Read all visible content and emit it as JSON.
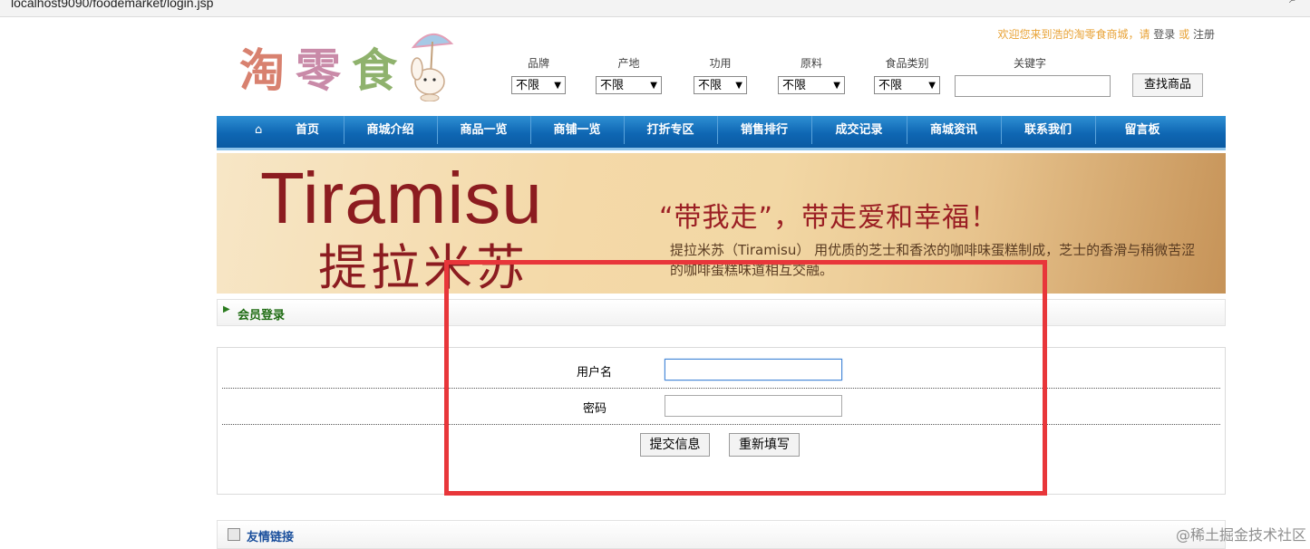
{
  "browser": {
    "url": "localhost:9090/foodemarket/login.jsp",
    "url_visible": "localhost9090/foodemarket/login.jsp"
  },
  "header": {
    "logo_text": [
      "淘",
      "零",
      "食"
    ],
    "welcome_text": "欢迎您来到浩的淘零食商城，请",
    "login_link": "登录",
    "or_text": "或",
    "register_link": "注册"
  },
  "filters": [
    {
      "label": "品牌",
      "value": "不限"
    },
    {
      "label": "产地",
      "value": "不限"
    },
    {
      "label": "功用",
      "value": "不限"
    },
    {
      "label": "原料",
      "value": "不限"
    },
    {
      "label": "食品类别",
      "value": "不限"
    }
  ],
  "keyword": {
    "label": "关键字",
    "value": ""
  },
  "search_button": "查找商品",
  "nav": {
    "items": [
      "首页",
      "商城介绍",
      "商品一览",
      "商铺一览",
      "打折专区",
      "销售排行",
      "成交记录",
      "商城资讯",
      "联系我们",
      "留言板"
    ]
  },
  "banner": {
    "title": "Tiramisu",
    "subtitle": "提拉米苏",
    "slogan": "“带我走”，带走爱和幸福！",
    "description": "提拉米苏（Tiramisu） 用优质的芝士和香浓的咖啡味蛋糕制成，芝士的香滑与稍微苦涩的咖啡蛋糕味道相互交融。"
  },
  "login_section": {
    "title": "会员登录",
    "username_label": "用户名",
    "password_label": "密码",
    "username_value": "",
    "password_value": "",
    "submit_label": "提交信息",
    "reset_label": "重新填写"
  },
  "links_section": {
    "title": "友情链接"
  },
  "watermark": "@稀土掘金技术社区",
  "colors": {
    "nav_blue": "#0f67b3",
    "highlight_red": "#e8363a",
    "welcome_orange": "#e8a235",
    "banner_red": "#8c1c20"
  }
}
